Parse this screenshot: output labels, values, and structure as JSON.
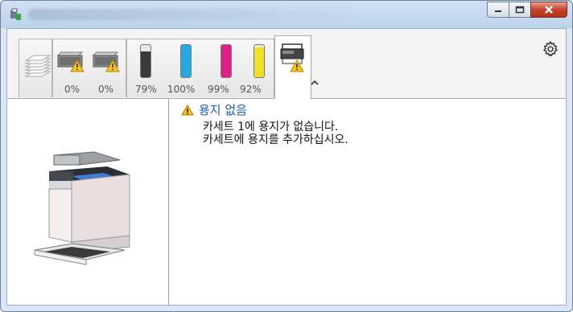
{
  "window": {
    "title": ""
  },
  "tabs": {
    "paper_stack": {
      "label": ""
    },
    "waste_toner_1": {
      "percent": "0%"
    },
    "waste_toner_2": {
      "percent": "0%"
    },
    "toner_black": {
      "percent": "79%",
      "color": "#3a3a3a",
      "level": 0.79
    },
    "toner_cyan": {
      "percent": "100%",
      "color": "#29a8e0",
      "level": 1.0
    },
    "toner_magenta": {
      "percent": "99%",
      "color": "#e0208a",
      "level": 0.99
    },
    "toner_yellow": {
      "percent": "92%",
      "color": "#f2df2a",
      "level": 0.92
    },
    "printer_status": {
      "label": ""
    }
  },
  "message": {
    "title": "용지 없음",
    "line1": "카세트 1에 용지가 없습니다.",
    "line2": "카세트에 용지를 추가하십시오."
  },
  "icons": [
    "app-icon",
    "minimize-icon",
    "maximize-icon",
    "close-icon",
    "gear-icon",
    "warning-icon",
    "chevron-up-icon",
    "printer-image"
  ]
}
